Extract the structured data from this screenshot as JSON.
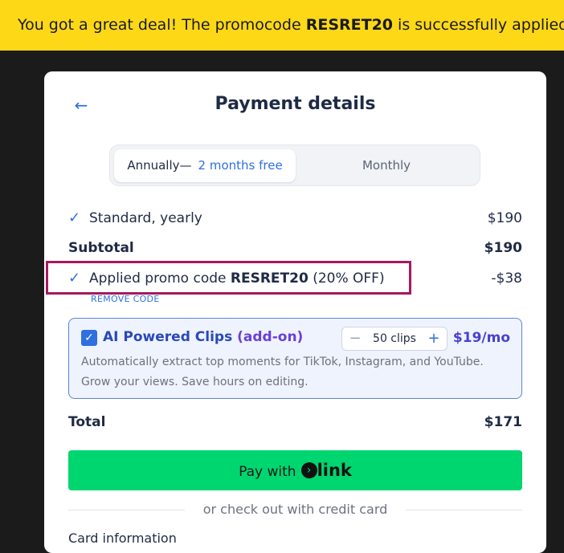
{
  "banner": {
    "prefix": "You got a great deal! The promocode ",
    "code": "RESRET20",
    "suffix": " is successfully applied"
  },
  "header": {
    "back_icon": "arrow-left-icon",
    "title": "Payment details"
  },
  "billing_toggle": {
    "annual_label": "Annually—",
    "annual_free": "2 months free",
    "monthly_label": "Monthly",
    "selected": "Annually"
  },
  "summary": {
    "plan_label": "Standard, yearly",
    "plan_price": "$190",
    "subtotal_label": "Subtotal",
    "subtotal_value": "$190",
    "promo_prefix": "Applied promo code ",
    "promo_code": "RESRET20",
    "promo_suffix": " (20% OFF)",
    "promo_discount": "-$38",
    "remove_code": "REMOVE CODE",
    "total_label": "Total",
    "total_value": "$171"
  },
  "addon": {
    "checked": true,
    "name": "AI Powered Clips",
    "tag": "(add-on)",
    "quantity": "50 clips",
    "price": "$19/mo",
    "description": "Automatically extract top moments for TikTok, Instagram, and YouTube. Grow your views. Save hours on editing."
  },
  "pay": {
    "label": "Pay with",
    "brand": "link"
  },
  "alt_checkout": "or check out with credit card",
  "card_info_label": "Card information",
  "colors": {
    "banner": "#fdd817",
    "accent": "#2f6fe0",
    "pay_button": "#00d66f",
    "highlight_box": "#a8185e"
  }
}
